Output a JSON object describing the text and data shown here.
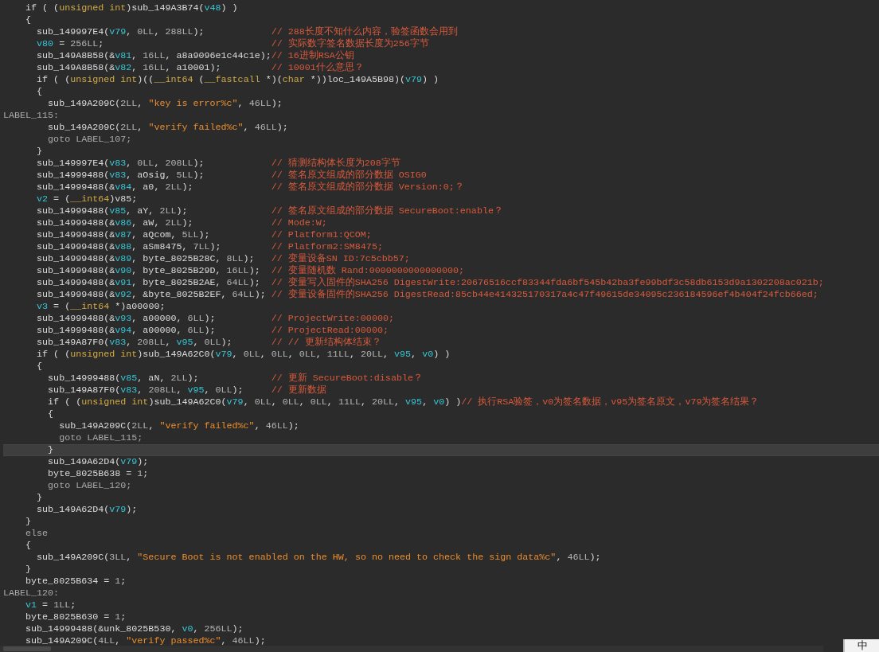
{
  "lines": [
    {
      "current": false,
      "code": [
        {
          "kind": "plain",
          "text": "    if ( ("
        },
        {
          "kind": "type",
          "text": "unsigned int"
        },
        {
          "kind": "plain",
          "text": ")sub_149A3B74("
        },
        {
          "kind": "var",
          "text": "v48"
        },
        {
          "kind": "plain",
          "text": ") )"
        }
      ]
    },
    {
      "current": false,
      "code": [
        {
          "kind": "plain",
          "text": "    {"
        }
      ]
    },
    {
      "current": false,
      "code": [
        {
          "kind": "plain",
          "text": "      sub_149997E4("
        },
        {
          "kind": "var",
          "text": "v79"
        },
        {
          "kind": "plain",
          "text": ", "
        },
        {
          "kind": "num",
          "text": "0LL"
        },
        {
          "kind": "plain",
          "text": ", "
        },
        {
          "kind": "num",
          "text": "288LL"
        },
        {
          "kind": "plain",
          "text": ");"
        }
      ],
      "comment": "// 288长度不知什么内容，验签函数会用到"
    },
    {
      "current": false,
      "code": [
        {
          "kind": "var",
          "text": "      v80"
        },
        {
          "kind": "plain",
          "text": " = "
        },
        {
          "kind": "num",
          "text": "256LL"
        },
        {
          "kind": "plain",
          "text": ";"
        }
      ],
      "comment": "// 实际数字签名数据长度为256字节"
    },
    {
      "current": false,
      "code": [
        {
          "kind": "plain",
          "text": "      sub_149A8B58(&"
        },
        {
          "kind": "var",
          "text": "v81"
        },
        {
          "kind": "plain",
          "text": ", "
        },
        {
          "kind": "num",
          "text": "16LL"
        },
        {
          "kind": "plain",
          "text": ", a8a9096e1c44c1e);"
        }
      ],
      "comment": "// 16进制RSA公钥"
    },
    {
      "current": false,
      "code": [
        {
          "kind": "plain",
          "text": "      sub_149A8B58(&"
        },
        {
          "kind": "var",
          "text": "v82"
        },
        {
          "kind": "plain",
          "text": ", "
        },
        {
          "kind": "num",
          "text": "16LL"
        },
        {
          "kind": "plain",
          "text": ", a10001);"
        }
      ],
      "comment": "// 10001什么意思？"
    },
    {
      "current": false,
      "code": [
        {
          "kind": "plain",
          "text": "      if ( ("
        },
        {
          "kind": "type",
          "text": "unsigned int"
        },
        {
          "kind": "plain",
          "text": ")(("
        },
        {
          "kind": "type",
          "text": "__int64"
        },
        {
          "kind": "plain",
          "text": " ("
        },
        {
          "kind": "type",
          "text": "__fastcall"
        },
        {
          "kind": "plain",
          "text": " *)("
        },
        {
          "kind": "type",
          "text": "char"
        },
        {
          "kind": "plain",
          "text": " *))loc_149A5B98)("
        },
        {
          "kind": "var",
          "text": "v79"
        },
        {
          "kind": "plain",
          "text": ") )"
        }
      ]
    },
    {
      "current": false,
      "code": [
        {
          "kind": "plain",
          "text": "      {"
        }
      ]
    },
    {
      "current": false,
      "code": [
        {
          "kind": "plain",
          "text": "        sub_149A209C("
        },
        {
          "kind": "num",
          "text": "2LL"
        },
        {
          "kind": "plain",
          "text": ", "
        },
        {
          "kind": "str",
          "text": "\"key is error%c\""
        },
        {
          "kind": "plain",
          "text": ", "
        },
        {
          "kind": "num",
          "text": "46LL"
        },
        {
          "kind": "plain",
          "text": ");"
        }
      ]
    },
    {
      "current": false,
      "code": [
        {
          "kind": "keyword",
          "text": "LABEL_115:"
        }
      ]
    },
    {
      "current": false,
      "code": [
        {
          "kind": "plain",
          "text": "        sub_149A209C("
        },
        {
          "kind": "num",
          "text": "2LL"
        },
        {
          "kind": "plain",
          "text": ", "
        },
        {
          "kind": "str",
          "text": "\"verify failed%c\""
        },
        {
          "kind": "plain",
          "text": ", "
        },
        {
          "kind": "num",
          "text": "46LL"
        },
        {
          "kind": "plain",
          "text": ");"
        }
      ]
    },
    {
      "current": false,
      "code": [
        {
          "kind": "keyword",
          "text": "        goto LABEL_107;"
        }
      ]
    },
    {
      "current": false,
      "code": [
        {
          "kind": "plain",
          "text": "      }"
        }
      ]
    },
    {
      "current": false,
      "code": [
        {
          "kind": "plain",
          "text": "      sub_149997E4("
        },
        {
          "kind": "var",
          "text": "v83"
        },
        {
          "kind": "plain",
          "text": ", "
        },
        {
          "kind": "num",
          "text": "0LL"
        },
        {
          "kind": "plain",
          "text": ", "
        },
        {
          "kind": "num",
          "text": "208LL"
        },
        {
          "kind": "plain",
          "text": ");"
        }
      ],
      "comment": "// 猜测结构体长度为208字节"
    },
    {
      "current": false,
      "code": [
        {
          "kind": "plain",
          "text": "      sub_14999488("
        },
        {
          "kind": "var",
          "text": "v83"
        },
        {
          "kind": "plain",
          "text": ", aOsig, "
        },
        {
          "kind": "num",
          "text": "5LL"
        },
        {
          "kind": "plain",
          "text": ");"
        }
      ],
      "comment": "// 签名原文组成的部分数据 OSIG0"
    },
    {
      "current": false,
      "code": [
        {
          "kind": "plain",
          "text": "      sub_14999488(&"
        },
        {
          "kind": "var",
          "text": "v84"
        },
        {
          "kind": "plain",
          "text": ", a0, "
        },
        {
          "kind": "num",
          "text": "2LL"
        },
        {
          "kind": "plain",
          "text": ");"
        }
      ],
      "comment": "// 签名原文组成的部分数据 Version:0;？"
    },
    {
      "current": false,
      "code": [
        {
          "kind": "var",
          "text": "      v2"
        },
        {
          "kind": "plain",
          "text": " = ("
        },
        {
          "kind": "type",
          "text": "__int64"
        },
        {
          "kind": "plain",
          "text": ")v85;"
        }
      ]
    },
    {
      "current": false,
      "code": [
        {
          "kind": "plain",
          "text": "      sub_14999488("
        },
        {
          "kind": "var",
          "text": "v85"
        },
        {
          "kind": "plain",
          "text": ", aY, "
        },
        {
          "kind": "num",
          "text": "2LL"
        },
        {
          "kind": "plain",
          "text": ");"
        }
      ],
      "comment": "// 签名原文组成的部分数据 SecureBoot:enable？"
    },
    {
      "current": false,
      "code": [
        {
          "kind": "plain",
          "text": "      sub_14999488(&"
        },
        {
          "kind": "var",
          "text": "v86"
        },
        {
          "kind": "plain",
          "text": ", aW, "
        },
        {
          "kind": "num",
          "text": "2LL"
        },
        {
          "kind": "plain",
          "text": ");"
        }
      ],
      "comment": "// Mode:W;"
    },
    {
      "current": false,
      "code": [
        {
          "kind": "plain",
          "text": "      sub_14999488(&"
        },
        {
          "kind": "var",
          "text": "v87"
        },
        {
          "kind": "plain",
          "text": ", aQcom, "
        },
        {
          "kind": "num",
          "text": "5LL"
        },
        {
          "kind": "plain",
          "text": ");"
        }
      ],
      "comment": "// Platform1:QCOM;"
    },
    {
      "current": false,
      "code": [
        {
          "kind": "plain",
          "text": "      sub_14999488(&"
        },
        {
          "kind": "var",
          "text": "v88"
        },
        {
          "kind": "plain",
          "text": ", aSm8475, "
        },
        {
          "kind": "num",
          "text": "7LL"
        },
        {
          "kind": "plain",
          "text": ");"
        }
      ],
      "comment": "// Platform2:SM8475;"
    },
    {
      "current": false,
      "code": [
        {
          "kind": "plain",
          "text": "      sub_14999488(&"
        },
        {
          "kind": "var",
          "text": "v89"
        },
        {
          "kind": "plain",
          "text": ", byte_8025B28C, "
        },
        {
          "kind": "num",
          "text": "8LL"
        },
        {
          "kind": "plain",
          "text": ");"
        }
      ],
      "comment": "// 变量设备SN ID:7c5cbb57;"
    },
    {
      "current": false,
      "code": [
        {
          "kind": "plain",
          "text": "      sub_14999488(&"
        },
        {
          "kind": "var",
          "text": "v90"
        },
        {
          "kind": "plain",
          "text": ", byte_8025B29D, "
        },
        {
          "kind": "num",
          "text": "16LL"
        },
        {
          "kind": "plain",
          "text": ");"
        }
      ],
      "comment": "// 变量随机数 Rand:0000000000000000;"
    },
    {
      "current": false,
      "code": [
        {
          "kind": "plain",
          "text": "      sub_14999488(&"
        },
        {
          "kind": "var",
          "text": "v91"
        },
        {
          "kind": "plain",
          "text": ", byte_8025B2AE, "
        },
        {
          "kind": "num",
          "text": "64LL"
        },
        {
          "kind": "plain",
          "text": ");"
        }
      ],
      "comment": "// 变量写入固件的SHA256 DigestWrite:20676516ccf83344fda6bf545b42ba3fe99bdf3c58db6153d9a1302208ac021b;"
    },
    {
      "current": false,
      "code": [
        {
          "kind": "plain",
          "text": "      sub_14999488(&"
        },
        {
          "kind": "var",
          "text": "v92"
        },
        {
          "kind": "plain",
          "text": ", &byte_8025B2EF, "
        },
        {
          "kind": "num",
          "text": "64LL"
        },
        {
          "kind": "plain",
          "text": ");"
        }
      ],
      "comment": "// 变量设备固件的SHA256 DigestRead:85cb44e414325170317a4c47f49615de34095c236184596ef4b404f24fcb66ed;"
    },
    {
      "current": false,
      "code": [
        {
          "kind": "var",
          "text": "      v3"
        },
        {
          "kind": "plain",
          "text": " = ("
        },
        {
          "kind": "type",
          "text": "__int64"
        },
        {
          "kind": "plain",
          "text": " *)a00000;"
        }
      ]
    },
    {
      "current": false,
      "code": [
        {
          "kind": "plain",
          "text": "      sub_14999488(&"
        },
        {
          "kind": "var",
          "text": "v93"
        },
        {
          "kind": "plain",
          "text": ", a00000, "
        },
        {
          "kind": "num",
          "text": "6LL"
        },
        {
          "kind": "plain",
          "text": ");"
        }
      ],
      "comment": "// ProjectWrite:00000;"
    },
    {
      "current": false,
      "code": [
        {
          "kind": "plain",
          "text": "      sub_14999488(&"
        },
        {
          "kind": "var",
          "text": "v94"
        },
        {
          "kind": "plain",
          "text": ", a00000, "
        },
        {
          "kind": "num",
          "text": "6LL"
        },
        {
          "kind": "plain",
          "text": ");"
        }
      ],
      "comment": "// ProjectRead:00000;"
    },
    {
      "current": false,
      "code": [
        {
          "kind": "plain",
          "text": "      sub_149A87F0("
        },
        {
          "kind": "var",
          "text": "v83"
        },
        {
          "kind": "plain",
          "text": ", "
        },
        {
          "kind": "num",
          "text": "208LL"
        },
        {
          "kind": "plain",
          "text": ", "
        },
        {
          "kind": "var",
          "text": "v95"
        },
        {
          "kind": "plain",
          "text": ", "
        },
        {
          "kind": "num",
          "text": "0LL"
        },
        {
          "kind": "plain",
          "text": ");"
        }
      ],
      "comment": "// // 更新结构体结束？"
    },
    {
      "current": false,
      "code": [
        {
          "kind": "plain",
          "text": "      if ( ("
        },
        {
          "kind": "type",
          "text": "unsigned int"
        },
        {
          "kind": "plain",
          "text": ")sub_149A62C0("
        },
        {
          "kind": "var",
          "text": "v79"
        },
        {
          "kind": "plain",
          "text": ", "
        },
        {
          "kind": "num",
          "text": "0LL"
        },
        {
          "kind": "plain",
          "text": ", "
        },
        {
          "kind": "num",
          "text": "0LL"
        },
        {
          "kind": "plain",
          "text": ", "
        },
        {
          "kind": "num",
          "text": "0LL"
        },
        {
          "kind": "plain",
          "text": ", "
        },
        {
          "kind": "num",
          "text": "11LL"
        },
        {
          "kind": "plain",
          "text": ", "
        },
        {
          "kind": "num",
          "text": "20LL"
        },
        {
          "kind": "plain",
          "text": ", "
        },
        {
          "kind": "var",
          "text": "v95"
        },
        {
          "kind": "plain",
          "text": ", "
        },
        {
          "kind": "var",
          "text": "v0"
        },
        {
          "kind": "plain",
          "text": ") )"
        }
      ]
    },
    {
      "current": false,
      "code": [
        {
          "kind": "plain",
          "text": "      {"
        }
      ]
    },
    {
      "current": false,
      "code": [
        {
          "kind": "plain",
          "text": "        sub_14999488("
        },
        {
          "kind": "var",
          "text": "v85"
        },
        {
          "kind": "plain",
          "text": ", aN, "
        },
        {
          "kind": "num",
          "text": "2LL"
        },
        {
          "kind": "plain",
          "text": ");"
        }
      ],
      "comment": "// 更新 SecureBoot:disable？"
    },
    {
      "current": false,
      "code": [
        {
          "kind": "plain",
          "text": "        sub_149A87F0("
        },
        {
          "kind": "var",
          "text": "v83"
        },
        {
          "kind": "plain",
          "text": ", "
        },
        {
          "kind": "num",
          "text": "208LL"
        },
        {
          "kind": "plain",
          "text": ", "
        },
        {
          "kind": "var",
          "text": "v95"
        },
        {
          "kind": "plain",
          "text": ", "
        },
        {
          "kind": "num",
          "text": "0LL"
        },
        {
          "kind": "plain",
          "text": ");"
        }
      ],
      "comment": "// 更新数据"
    },
    {
      "current": false,
      "code": [
        {
          "kind": "plain",
          "text": "        if ( ("
        },
        {
          "kind": "type",
          "text": "unsigned int"
        },
        {
          "kind": "plain",
          "text": ")sub_149A62C0("
        },
        {
          "kind": "var",
          "text": "v79"
        },
        {
          "kind": "plain",
          "text": ", "
        },
        {
          "kind": "num",
          "text": "0LL"
        },
        {
          "kind": "plain",
          "text": ", "
        },
        {
          "kind": "num",
          "text": "0LL"
        },
        {
          "kind": "plain",
          "text": ", "
        },
        {
          "kind": "num",
          "text": "0LL"
        },
        {
          "kind": "plain",
          "text": ", "
        },
        {
          "kind": "num",
          "text": "11LL"
        },
        {
          "kind": "plain",
          "text": ", "
        },
        {
          "kind": "num",
          "text": "20LL"
        },
        {
          "kind": "plain",
          "text": ", "
        },
        {
          "kind": "var",
          "text": "v95"
        },
        {
          "kind": "plain",
          "text": ", "
        },
        {
          "kind": "var",
          "text": "v0"
        },
        {
          "kind": "plain",
          "text": ") )"
        }
      ],
      "comment": "// 执行RSA验签，v0为签名数据，v95为签名原文，v79为签名结果？"
    },
    {
      "current": false,
      "code": [
        {
          "kind": "plain",
          "text": "        {"
        }
      ]
    },
    {
      "current": false,
      "code": [
        {
          "kind": "plain",
          "text": "          sub_149A209C("
        },
        {
          "kind": "num",
          "text": "2LL"
        },
        {
          "kind": "plain",
          "text": ", "
        },
        {
          "kind": "str",
          "text": "\"verify failed%c\""
        },
        {
          "kind": "plain",
          "text": ", "
        },
        {
          "kind": "num",
          "text": "46LL"
        },
        {
          "kind": "plain",
          "text": ");"
        }
      ]
    },
    {
      "current": false,
      "code": [
        {
          "kind": "keyword",
          "text": "          goto LABEL_115;"
        }
      ]
    },
    {
      "current": true,
      "code": [
        {
          "kind": "plain",
          "text": "        }"
        }
      ]
    },
    {
      "current": false,
      "code": [
        {
          "kind": "plain",
          "text": "        sub_149A62D4("
        },
        {
          "kind": "var",
          "text": "v79"
        },
        {
          "kind": "plain",
          "text": ");"
        }
      ]
    },
    {
      "current": false,
      "code": [
        {
          "kind": "plain",
          "text": "        byte_8025B638 = "
        },
        {
          "kind": "num",
          "text": "1"
        },
        {
          "kind": "plain",
          "text": ";"
        }
      ]
    },
    {
      "current": false,
      "code": [
        {
          "kind": "keyword",
          "text": "        goto LABEL_120;"
        }
      ]
    },
    {
      "current": false,
      "code": [
        {
          "kind": "plain",
          "text": "      }"
        }
      ]
    },
    {
      "current": false,
      "code": [
        {
          "kind": "plain",
          "text": "      sub_149A62D4("
        },
        {
          "kind": "var",
          "text": "v79"
        },
        {
          "kind": "plain",
          "text": ");"
        }
      ]
    },
    {
      "current": false,
      "code": [
        {
          "kind": "plain",
          "text": "    }"
        }
      ]
    },
    {
      "current": false,
      "code": [
        {
          "kind": "keyword",
          "text": "    else"
        }
      ]
    },
    {
      "current": false,
      "code": [
        {
          "kind": "plain",
          "text": "    {"
        }
      ]
    },
    {
      "current": false,
      "code": [
        {
          "kind": "plain",
          "text": "      sub_149A209C("
        },
        {
          "kind": "num",
          "text": "3LL"
        },
        {
          "kind": "plain",
          "text": ", "
        },
        {
          "kind": "str",
          "text": "\"Secure Boot is not enabled on the HW, so no need to check the sign data%c\""
        },
        {
          "kind": "plain",
          "text": ", "
        },
        {
          "kind": "num",
          "text": "46LL"
        },
        {
          "kind": "plain",
          "text": ");"
        }
      ]
    },
    {
      "current": false,
      "code": [
        {
          "kind": "plain",
          "text": "    }"
        }
      ]
    },
    {
      "current": false,
      "code": [
        {
          "kind": "plain",
          "text": "    byte_8025B634 = "
        },
        {
          "kind": "num",
          "text": "1"
        },
        {
          "kind": "plain",
          "text": ";"
        }
      ]
    },
    {
      "current": false,
      "code": [
        {
          "kind": "keyword",
          "text": "LABEL_120:"
        }
      ]
    },
    {
      "current": false,
      "code": [
        {
          "kind": "var",
          "text": "    v1"
        },
        {
          "kind": "plain",
          "text": " = "
        },
        {
          "kind": "num",
          "text": "1LL"
        },
        {
          "kind": "plain",
          "text": ";"
        }
      ]
    },
    {
      "current": false,
      "code": [
        {
          "kind": "plain",
          "text": "    byte_8025B630 = "
        },
        {
          "kind": "num",
          "text": "1"
        },
        {
          "kind": "plain",
          "text": ";"
        }
      ]
    },
    {
      "current": false,
      "code": [
        {
          "kind": "plain",
          "text": "    sub_14999488(&unk_8025B530, "
        },
        {
          "kind": "var",
          "text": "v0"
        },
        {
          "kind": "plain",
          "text": ", "
        },
        {
          "kind": "num",
          "text": "256LL"
        },
        {
          "kind": "plain",
          "text": ");"
        }
      ]
    },
    {
      "current": false,
      "code": [
        {
          "kind": "plain",
          "text": "    sub_149A209C("
        },
        {
          "kind": "num",
          "text": "4LL"
        },
        {
          "kind": "plain",
          "text": ", "
        },
        {
          "kind": "str",
          "text": "\"verify passed%c\""
        },
        {
          "kind": "plain",
          "text": ", "
        },
        {
          "kind": "num",
          "text": "46LL"
        },
        {
          "kind": "plain",
          "text": ");"
        }
      ]
    }
  ],
  "ime_indicator": "中"
}
